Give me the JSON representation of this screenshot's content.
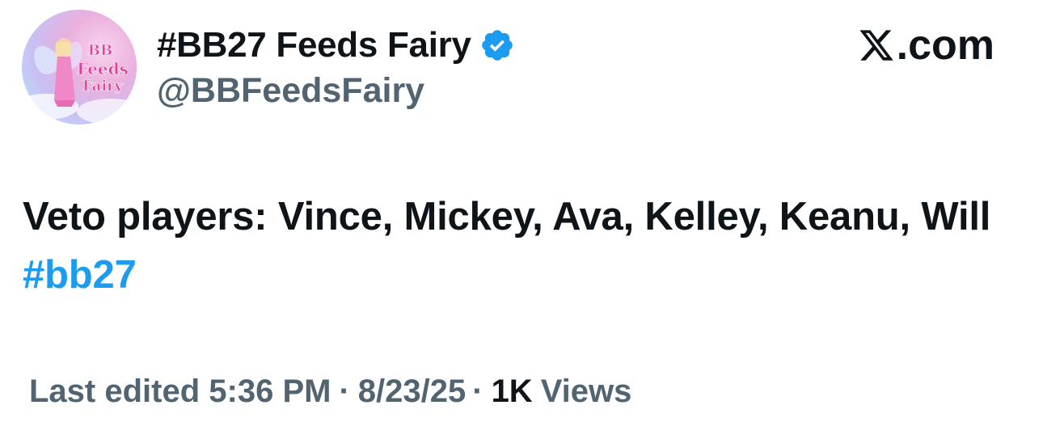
{
  "author": {
    "display_name": "#BB27 Feeds Fairy",
    "handle": "@BBFeedsFairy",
    "avatar_text": "BB Feeds Fairy",
    "verified": true
  },
  "brand": {
    "label": ".com"
  },
  "tweet": {
    "text_before_hashtag": "Veto players: Vince, Mickey, Ava, Kelley, Keanu, Will",
    "hashtag": "#bb27"
  },
  "meta": {
    "edited_label": "Last edited 5:36 PM",
    "separator": "·",
    "date": "8/23/25",
    "views_count": "1K",
    "views_label": "Views"
  },
  "colors": {
    "text_primary": "#0f1419",
    "text_secondary": "#536471",
    "link": "#1d9bf0",
    "verified_badge": "#1d9bf0"
  },
  "icons": {
    "verified": "verified-badge-icon",
    "brand": "x-logo-icon"
  }
}
